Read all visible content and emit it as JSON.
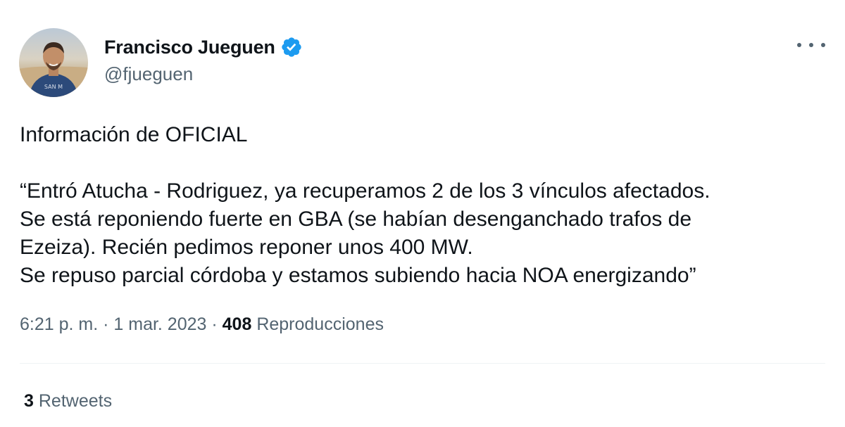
{
  "author": {
    "name": "Francisco Jueguen",
    "handle": "@fjueguen",
    "verified_icon": "verified-badge-icon",
    "avatar_icon": "profile-photo"
  },
  "menu": {
    "more_icon": "more-horizontal-icon"
  },
  "tweet": {
    "lines": [
      "Información de OFICIAL",
      "“Entró Atucha - Rodriguez, ya recuperamos 2 de los 3 vínculos afectados.",
      "Se está reponiendo fuerte en GBA (se habían desenganchado trafos de",
      "Ezeiza). Recién pedimos reponer unos 400 MW.",
      "Se repuso parcial córdoba y estamos subiendo hacia NOA energizando”"
    ]
  },
  "meta": {
    "time": "6:21 p. m.",
    "separator": " · ",
    "date": "1 mar. 2023",
    "views_count": "408",
    "views_label": "Reproducciones"
  },
  "stats": {
    "retweets_count": "3",
    "retweets_label": "Retweets"
  },
  "colors": {
    "text": "#0f1419",
    "secondary": "#536471",
    "verified": "#1d9bf0",
    "divider": "#eff3f4"
  }
}
